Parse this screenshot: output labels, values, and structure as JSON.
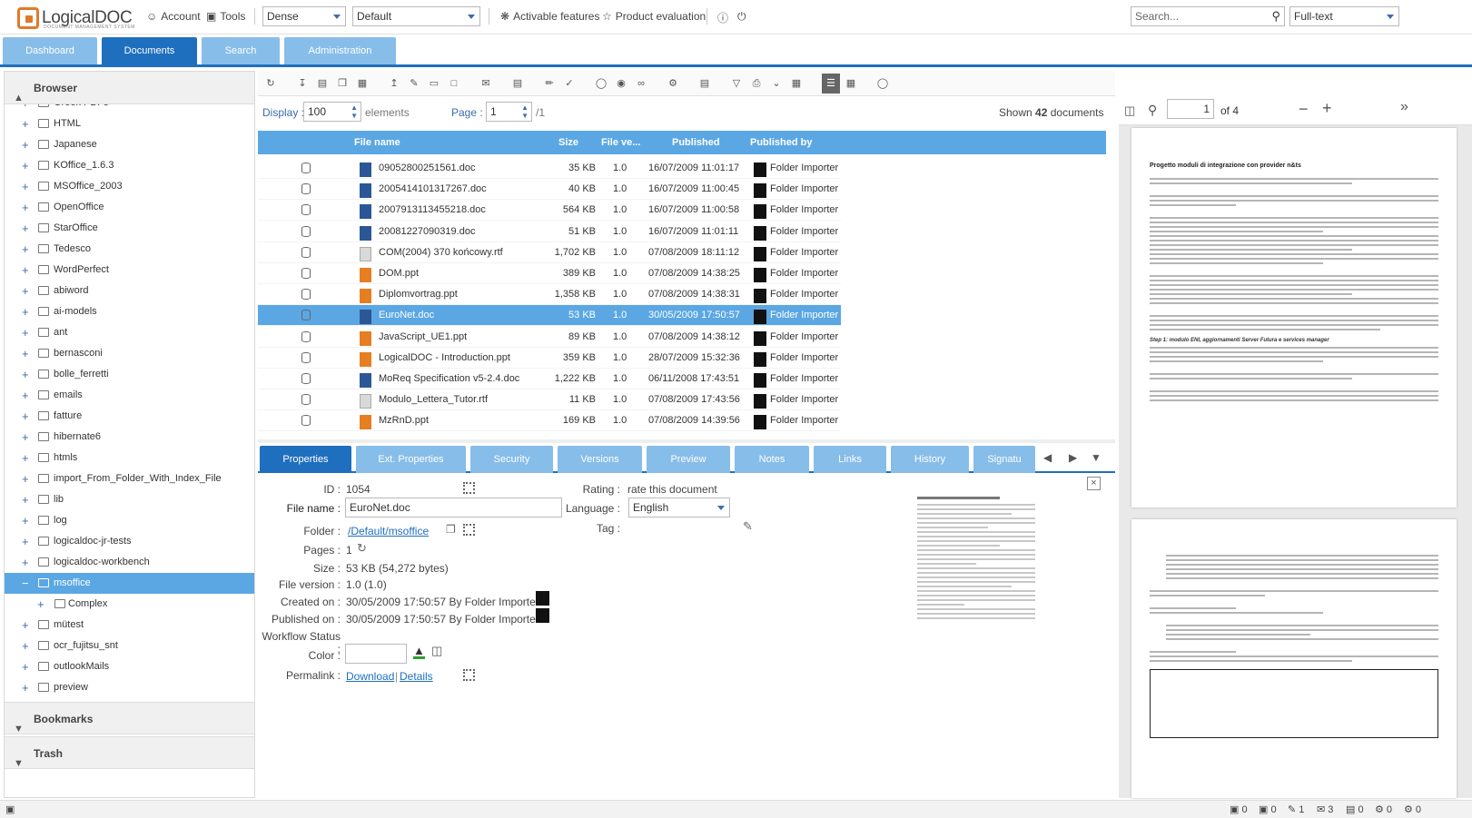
{
  "app": {
    "logo_name": "LogicalDOC",
    "logo_tagline": "DOCUMENT MANAGEMENT SYSTEM",
    "brand_color": "#e07a2a",
    "accent_color": "#1f6fbf"
  },
  "topbar": {
    "account": "Account",
    "tools": "Tools",
    "density_select": "Dense",
    "workspace_select": "Default",
    "activable_features": "Activable features",
    "product_evaluation": "Product evaluation",
    "search_placeholder": "Search...",
    "search_mode": "Full-text"
  },
  "tabs": [
    "Dashboard",
    "Documents",
    "Search",
    "Administration"
  ],
  "left": {
    "browser": "Browser",
    "tree": [
      "Greek PDFs",
      "HTML",
      "Japanese",
      "KOffice_1.6.3",
      "MSOffice_2003",
      "OpenOffice",
      "StarOffice",
      "Tedesco",
      "WordPerfect",
      "abiword",
      "ai-models",
      "ant",
      "bernasconi",
      "bolle_ferretti",
      "emails",
      "fatture",
      "hibernate6",
      "htmls",
      "import_From_Folder_With_Index_File",
      "lib",
      "log",
      "logicaldoc-jr-tests",
      "logicaldoc-workbench",
      "msoffice",
      "Complex",
      "mütest",
      "ocr_fujitsu_snt",
      "outlookMails",
      "preview"
    ],
    "bookmarks": "Bookmarks",
    "trash": "Trash"
  },
  "pager": {
    "display_label": "Display :",
    "display_value": "100",
    "elements_label": "elements",
    "page_label": "Page :",
    "page_value": "1",
    "page_total": "/1",
    "shown_prefix": "Shown",
    "shown_count": "42",
    "shown_suffix": "documents"
  },
  "grid": {
    "headers": [
      "File name",
      "Size",
      "File ve...",
      "Published",
      "Published by"
    ],
    "rows": [
      {
        "icon": "doc",
        "name": "09052800251561.doc",
        "size": "35 KB",
        "ver": "1.0",
        "published": "16/07/2009 11:01:17",
        "by": "Folder Importer"
      },
      {
        "icon": "doc",
        "name": "2005414101317267.doc",
        "size": "40 KB",
        "ver": "1.0",
        "published": "16/07/2009 11:00:45",
        "by": "Folder Importer"
      },
      {
        "icon": "doc",
        "name": "2007913113455218.doc",
        "size": "564 KB",
        "ver": "1.0",
        "published": "16/07/2009 11:00:58",
        "by": "Folder Importer"
      },
      {
        "icon": "doc",
        "name": "20081227090319.doc",
        "size": "51 KB",
        "ver": "1.0",
        "published": "16/07/2009 11:01:11",
        "by": "Folder Importer"
      },
      {
        "icon": "rtf",
        "name": "COM(2004) 370 końcowy.rtf",
        "size": "1,702 KB",
        "ver": "1.0",
        "published": "07/08/2009 18:11:12",
        "by": "Folder Importer"
      },
      {
        "icon": "ppt",
        "name": "DOM.ppt",
        "size": "389 KB",
        "ver": "1.0",
        "published": "07/08/2009 14:38:25",
        "by": "Folder Importer"
      },
      {
        "icon": "ppt",
        "name": "Diplomvortrag.ppt",
        "size": "1,358 KB",
        "ver": "1.0",
        "published": "07/08/2009 14:38:31",
        "by": "Folder Importer"
      },
      {
        "icon": "doc",
        "name": "EuroNet.doc",
        "size": "53 KB",
        "ver": "1.0",
        "published": "30/05/2009 17:50:57",
        "by": "Folder Importer",
        "selected": true
      },
      {
        "icon": "ppt",
        "name": "JavaScript_UE1.ppt",
        "size": "89 KB",
        "ver": "1.0",
        "published": "07/08/2009 14:38:12",
        "by": "Folder Importer"
      },
      {
        "icon": "ppt",
        "name": "LogicalDOC - Introduction.ppt",
        "size": "359 KB",
        "ver": "1.0",
        "published": "28/07/2009 15:32:36",
        "by": "Folder Importer"
      },
      {
        "icon": "doc",
        "name": "MoReq Specification v5-2.4.doc",
        "size": "1,222 KB",
        "ver": "1.0",
        "published": "06/11/2008 17:43:51",
        "by": "Folder Importer"
      },
      {
        "icon": "rtf",
        "name": "Modulo_Lettera_Tutor.rtf",
        "size": "11 KB",
        "ver": "1.0",
        "published": "07/08/2009 17:43:56",
        "by": "Folder Importer"
      },
      {
        "icon": "ppt",
        "name": "MzRnD.ppt",
        "size": "169 KB",
        "ver": "1.0",
        "published": "07/08/2009 14:39:56",
        "by": "Folder Importer"
      }
    ]
  },
  "ptabs": [
    "Properties",
    "Ext. Properties",
    "Security",
    "Versions",
    "Preview",
    "Notes",
    "Links",
    "History",
    "Signatu"
  ],
  "props": {
    "id_label": "ID :",
    "id_value": "1054",
    "filename_label": "File name :",
    "filename_value": "EuroNet.doc",
    "folder_label": "Folder :",
    "folder_value": "/Default/msoffice",
    "pages_label": "Pages :",
    "pages_value": "1",
    "size_label": "Size :",
    "size_value": "53 KB (54,272 bytes)",
    "fileversion_label": "File version :",
    "fileversion_value": "1.0 (1.0)",
    "created_label": "Created on :",
    "created_value": "30/05/2009 17:50:57 By Folder Importer",
    "published_label": "Published on :",
    "published_value": "30/05/2009 17:50:57 By Folder Importer",
    "workflow_label": "Workflow Status :",
    "color_label": "Color :",
    "permalink_label": "Permalink :",
    "download": "Download",
    "details": "Details",
    "rating_label": "Rating :",
    "rating_value": "rate this document",
    "language_label": "Language :",
    "language_value": "English",
    "tag_label": "Tag :"
  },
  "preview": {
    "page_value": "1",
    "page_of": "of 4",
    "doc_title": "Progetto moduli di integrazione con provider n&ts",
    "section_title": "Step 1: modulo ENI, aggiornamenti Server Futura e services manager"
  },
  "statusbar": [
    "0",
    "0",
    "1",
    "3",
    "0",
    "0",
    "0"
  ]
}
